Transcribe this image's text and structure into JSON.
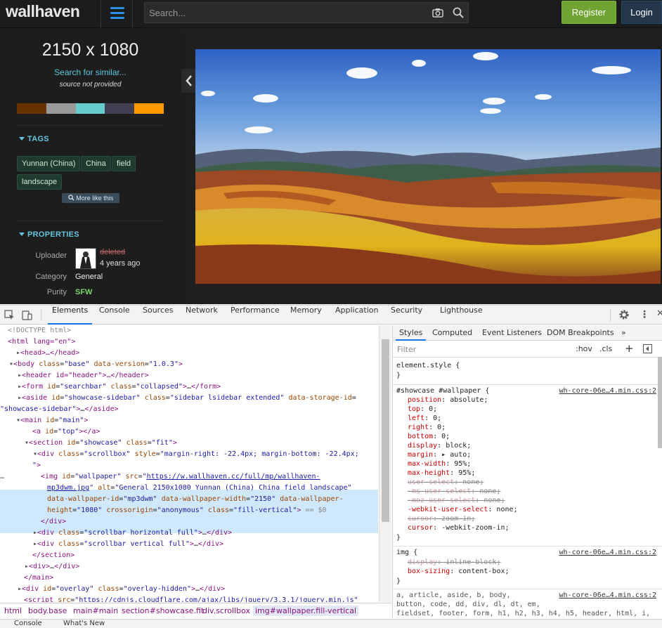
{
  "header": {
    "logo": "wallhaven",
    "search_placeholder": "Search...",
    "register_label": "Register",
    "login_label": "Login"
  },
  "sidebar": {
    "resolution": "2150 x 1080",
    "search_similar": "Search for similar...",
    "source": "source not provided",
    "palette": [
      "#663300",
      "#999999",
      "#66cccc",
      "#424153",
      "#ff9900"
    ],
    "tags_heading": "TAGS",
    "tags": [
      "Yunnan (China)",
      "China",
      "field",
      "landscape"
    ],
    "more_like_this": "More like this",
    "properties_heading": "PROPERTIES",
    "uploader_label": "Uploader",
    "uploader_name": "deleted",
    "uploaded_ago": "4 years ago",
    "category_label": "Category",
    "category_value": "General",
    "purity_label": "Purity",
    "purity_value": "SFW"
  },
  "devtools": {
    "tabs": [
      "Elements",
      "Console",
      "Sources",
      "Network",
      "Performance",
      "Memory",
      "Application",
      "Security",
      "Lighthouse"
    ],
    "dom": {
      "doctype": "<!DOCTYPE html>",
      "html_open": "<html lang=\"en\">",
      "head": "<head>…</head>",
      "body_tag": "body",
      "body_class": "base",
      "body_version": "1.0.3",
      "header_line": "<header id=\"header\">…</header>",
      "form_id": "searchbar",
      "form_class": "collapsed",
      "aside_id": "showcase-sidebar",
      "aside_class": "sidebar lsidebar extended",
      "aside_storage": "showcase-sidebar",
      "main_id": "main",
      "a_id": "top",
      "section_id": "showcase",
      "section_class": "fit",
      "scrollbox_class": "scrollbox",
      "scrollbox_style": "margin-right: -22.4px; margin-bottom: -22.4px;",
      "img_id": "wallpaper",
      "img_src_1": "https://w.wallhaven.cc/full/mp/wallhaven-",
      "img_src_2": "mp3dwm.jpg",
      "img_alt": "General 2150x1080 Yunnan (China) China field landscape",
      "img_wid": "mp3dwm",
      "img_width": "2150",
      "img_height": "1080",
      "img_cross": "anonymous",
      "img_class": "fill-vertical",
      "eq": "== $0",
      "sb_h": "scrollbar horizontal full",
      "sb_v": "scrollbar vertical full",
      "overlay_id": "overlay",
      "overlay_class": "overlay-hidden",
      "script_src": "https://cdnjs.cloudflare.com/ajax/libs/jquery/3.3.1/jquery.min.js"
    },
    "breadcrumbs": [
      "html",
      "body.base",
      "main#main",
      "section#showcase.fit",
      "div.scrollbox",
      "img#wallpaper.fill-vertical"
    ],
    "styles_tabs": [
      "Styles",
      "Computed",
      "Event Listeners",
      "DOM Breakpoints"
    ],
    "filter_placeholder": "Filter",
    "hov": ":hov",
    "cls": ".cls",
    "element_style": "element.style {",
    "rule1_selector": "#showcase #wallpaper {",
    "rule1_source": "wh-core-06e…4.min.css:2",
    "rule2_selector": "img {",
    "rule2_source": "wh-core-06e…4.min.css:2",
    "rule3_selector": "a, article, aside, b, body,",
    "rule3_line2": "button, code, dd, div, dl, dt, em,",
    "rule3_line3": "fieldset, footer, form, h1, h2, h3, h4, h5, header, html, i,",
    "rule3_source": "wh-core-06e…4.min.css:2",
    "drawer_tabs": [
      "Console",
      "What's New"
    ]
  }
}
